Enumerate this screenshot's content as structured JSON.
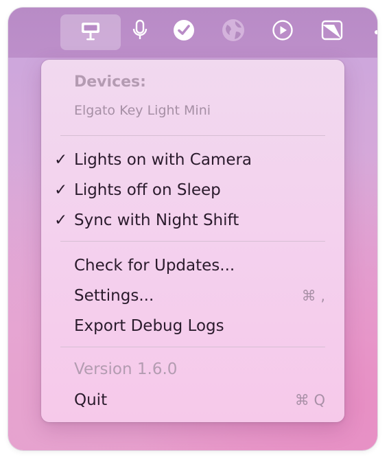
{
  "menubar": {
    "icons": [
      {
        "name": "key-light-icon",
        "active": true
      },
      {
        "name": "microphone-icon"
      },
      {
        "name": "checkmark-circle-icon"
      },
      {
        "name": "globe-icon"
      },
      {
        "name": "play-circle-icon"
      },
      {
        "name": "cursor-square-icon"
      }
    ]
  },
  "menu": {
    "devices_header": "Devices:",
    "device_name": "Elgato Key Light Mini",
    "options": [
      {
        "label": "Lights on with Camera",
        "checked": true,
        "check_glyph": "✓"
      },
      {
        "label": "Lights off on Sleep",
        "checked": true,
        "check_glyph": "✓"
      },
      {
        "label": "Sync with Night Shift",
        "checked": true,
        "check_glyph": "✓"
      }
    ],
    "actions": [
      {
        "label": "Check for Updates...",
        "shortcut": ""
      },
      {
        "label": "Settings...",
        "shortcut": "⌘ ,"
      },
      {
        "label": "Export Debug Logs",
        "shortcut": ""
      }
    ],
    "version": "Version 1.6.0",
    "quit": {
      "label": "Quit",
      "shortcut": "⌘ Q"
    }
  },
  "colors": {
    "menu_text": "#2a1b2c",
    "disabled_text": "#b49bb2",
    "menubar_bg": "#b88bc6"
  }
}
